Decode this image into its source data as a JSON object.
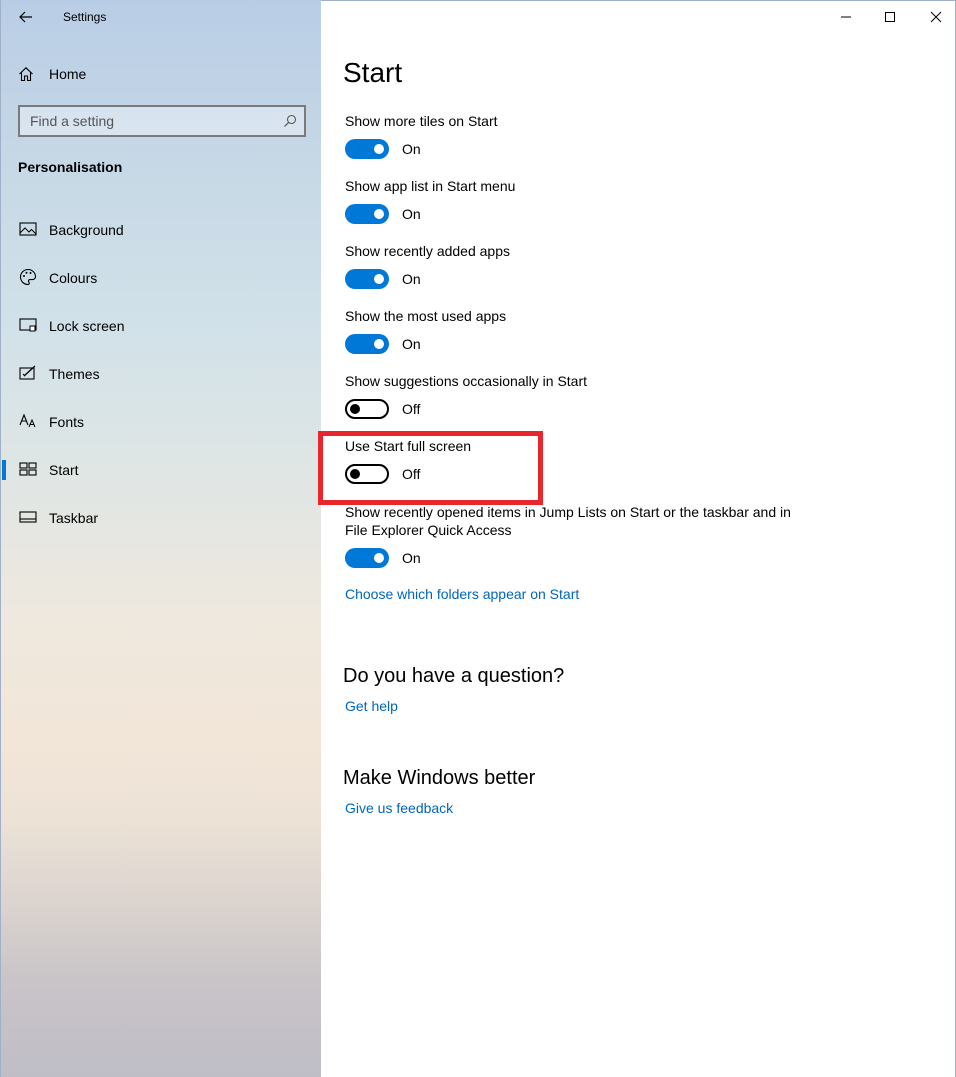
{
  "window": {
    "title": "Settings",
    "back_icon": "back-arrow-icon",
    "minimize_icon": "minimize-icon",
    "maximize_icon": "maximize-icon",
    "close_icon": "close-icon"
  },
  "sidebar": {
    "home_label": "Home",
    "home_icon": "home-icon",
    "search_placeholder": "Find a setting",
    "search_icon": "search-icon",
    "section_title": "Personalisation",
    "items": [
      {
        "label": "Background",
        "icon": "picture-icon",
        "active": false
      },
      {
        "label": "Colours",
        "icon": "palette-icon",
        "active": false
      },
      {
        "label": "Lock screen",
        "icon": "lock-screen-icon",
        "active": false
      },
      {
        "label": "Themes",
        "icon": "themes-icon",
        "active": false
      },
      {
        "label": "Fonts",
        "icon": "fonts-icon",
        "active": false
      },
      {
        "label": "Start",
        "icon": "start-icon",
        "active": true
      },
      {
        "label": "Taskbar",
        "icon": "taskbar-icon",
        "active": false
      }
    ]
  },
  "main": {
    "title": "Start",
    "settings": [
      {
        "label": "Show more tiles on Start",
        "state": "On"
      },
      {
        "label": "Show app list in Start menu",
        "state": "On"
      },
      {
        "label": "Show recently added apps",
        "state": "On"
      },
      {
        "label": "Show the most used apps",
        "state": "On"
      },
      {
        "label": "Show suggestions occasionally in Start",
        "state": "Off"
      },
      {
        "label": "Use Start full screen",
        "state": "Off"
      },
      {
        "label": "Show recently opened items in Jump Lists on Start or the taskbar and in File Explorer Quick Access",
        "state": "On"
      }
    ],
    "folders_link": "Choose which folders appear on Start",
    "question_heading": "Do you have a question?",
    "help_link": "Get help",
    "feedback_heading": "Make Windows better",
    "feedback_link": "Give us feedback"
  },
  "colors": {
    "accent": "#0078d7",
    "link": "#0067b8",
    "highlight": "#e8262b"
  }
}
